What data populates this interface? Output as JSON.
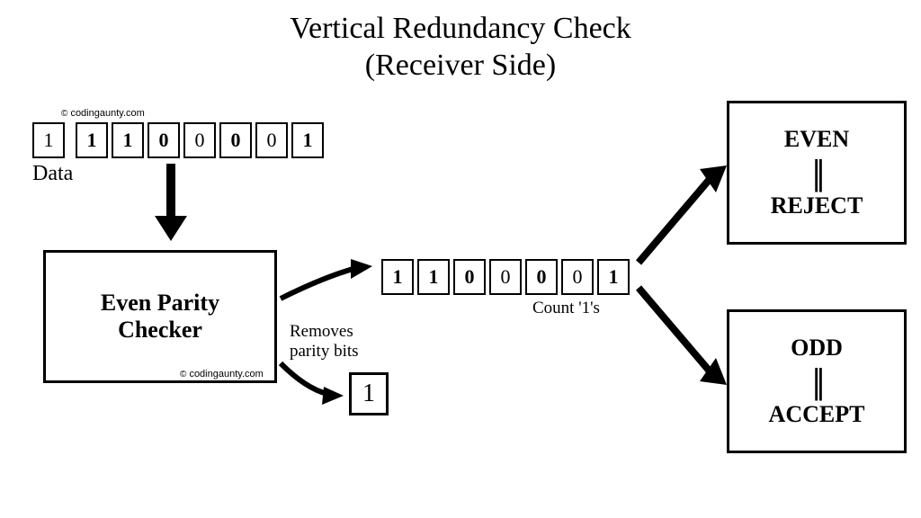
{
  "title_line1": "Vertical Redundancy Check",
  "title_line2": "(Receiver Side)",
  "credit": "codingaunty.com",
  "credit_symbol": "©",
  "data_label": "Data",
  "input_bits": [
    "1",
    "1",
    "1",
    "0",
    "0",
    "0",
    "0",
    "1"
  ],
  "input_bold": [
    false,
    true,
    true,
    true,
    false,
    true,
    false,
    true
  ],
  "checker_line1": "Even Parity",
  "checker_line2": "Checker",
  "removes_line1": "Removes",
  "removes_line2": "parity bits",
  "parity_bit": "1",
  "output_bits": [
    "1",
    "1",
    "0",
    "0",
    "0",
    "0",
    "1"
  ],
  "output_bold": [
    true,
    true,
    true,
    false,
    true,
    false,
    true
  ],
  "count_label": "Count '1's",
  "even_label": "EVEN",
  "reject_label": "REJECT",
  "odd_label": "ODD",
  "accept_label": "ACCEPT"
}
